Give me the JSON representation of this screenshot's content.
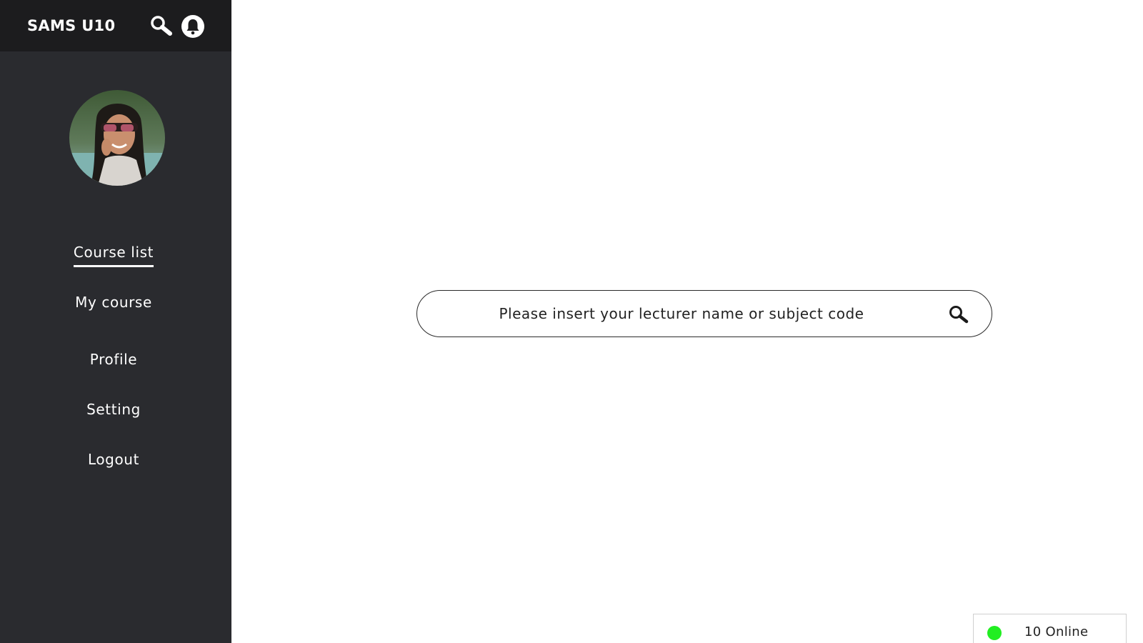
{
  "app": {
    "title": "SAMS U10"
  },
  "header": {
    "search_icon": "search-icon",
    "notification_icon": "bell-icon"
  },
  "sidebar": {
    "items": [
      {
        "label": "Course list",
        "active": true
      },
      {
        "label": "My course",
        "active": false
      },
      {
        "label": "Profile",
        "active": false
      },
      {
        "label": "Setting",
        "active": false
      },
      {
        "label": "Logout",
        "active": false
      }
    ]
  },
  "search": {
    "placeholder": "Please insert your lecturer name or subject code",
    "icon": "search-icon"
  },
  "status": {
    "online_text": "10 Online",
    "dot_color": "#22ee22"
  },
  "colors": {
    "sidebar_bg": "#2a2b2f",
    "header_bg": "#1c1c1e",
    "text_light": "#ffffff"
  }
}
